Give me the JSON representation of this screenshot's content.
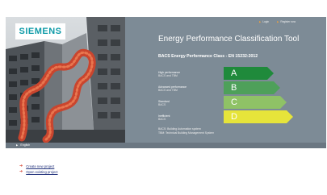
{
  "header": {
    "brand": "SIEMENS",
    "nav": {
      "login": "Login",
      "register": "Register now"
    }
  },
  "hero": {
    "app_title": "Energy Performance Classification Tool",
    "subtitle": "BACS Energy Performance Class - EN 15232:2012",
    "classes": [
      {
        "label": "High performance",
        "sub": "BACS and TBM",
        "letter": "A",
        "color": "#1f8a3b"
      },
      {
        "label": "Advanced performance",
        "sub": "BACS and TBM",
        "letter": "B",
        "color": "#4ea05a"
      },
      {
        "label": "Standard",
        "sub": "BACS",
        "letter": "C",
        "color": "#8fc266"
      },
      {
        "label": "Inefficient",
        "sub": "BACS",
        "letter": "D",
        "color": "#e6e43a"
      }
    ],
    "notes": [
      "BACS: Building Automation system",
      "TBM: Technical Building Management System"
    ]
  },
  "footer": {
    "language": "English"
  },
  "links": {
    "create": "Create new project",
    "open": "Open existing project"
  },
  "colors": {
    "hero_bg": "#7d8b96",
    "brand": "#0f9ba8",
    "link_arrow": "#d23b2a",
    "link": "#1f2f7a"
  }
}
